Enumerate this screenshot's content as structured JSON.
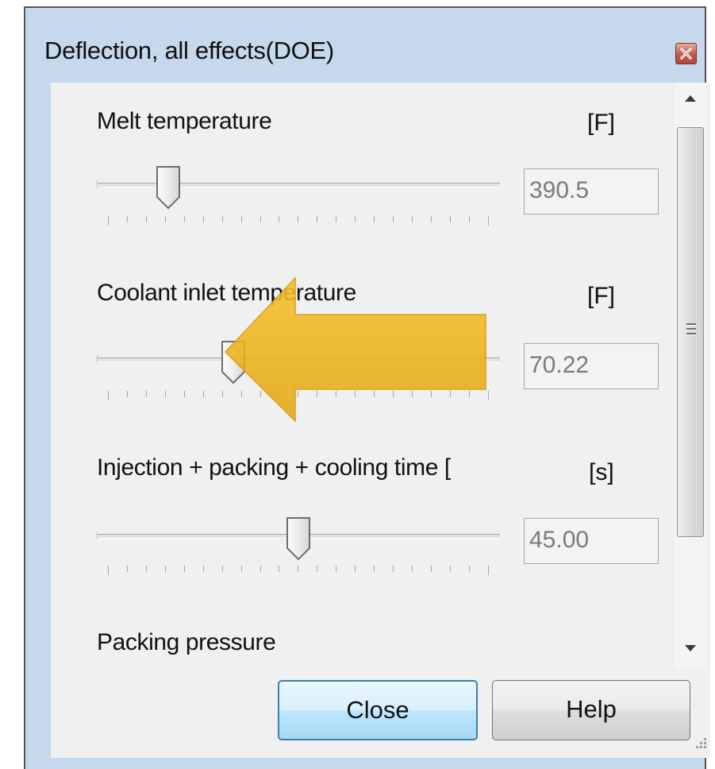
{
  "window": {
    "title": "Deflection, all effects(DOE)",
    "close_icon": "close-x-icon"
  },
  "parameters": [
    {
      "label": "Melt temperature",
      "unit": "[F]",
      "value": "390.5",
      "slider_fraction": 0.18
    },
    {
      "label": "Coolant inlet temperature",
      "unit": "[F]",
      "value": "70.22",
      "slider_fraction": 0.34
    },
    {
      "label": "Injection + packing + cooling time [",
      "unit": "[s]",
      "value": "45.00",
      "slider_fraction": 0.5
    },
    {
      "label": "Packing pressure"
    }
  ],
  "buttons": {
    "close_label": "Close",
    "help_label": "Help"
  },
  "annotation": {
    "type": "callout-arrow",
    "color": "#f0b414",
    "points_to": "Coolant inlet temperature slider thumb"
  },
  "colors": {
    "frame": "#c6d8ec",
    "panel": "#f0f0f0",
    "default_button_border": "#3c7fb1"
  }
}
